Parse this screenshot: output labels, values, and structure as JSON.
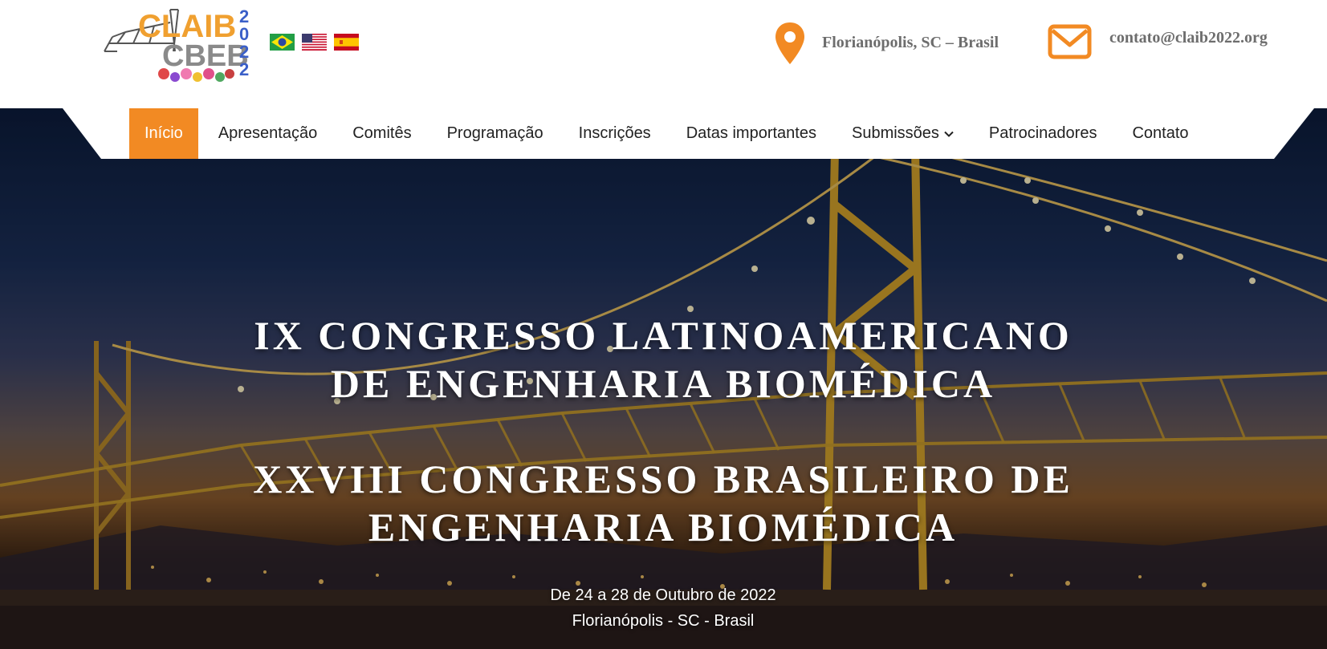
{
  "header": {
    "logo": {
      "top_text": "CLAIB",
      "bottom_text": "CBEB",
      "year_vertical": "2022"
    },
    "flags": [
      {
        "name": "brazil-flag-icon"
      },
      {
        "name": "usa-flag-icon"
      },
      {
        "name": "spain-flag-icon"
      }
    ],
    "location": {
      "icon": "map-pin-icon",
      "text": "Florianópolis, SC – Brasil"
    },
    "contact": {
      "icon": "envelope-icon",
      "text": "contato@claib2022.org"
    }
  },
  "nav": {
    "items": [
      {
        "label": "Início",
        "active": true
      },
      {
        "label": "Apresentação"
      },
      {
        "label": "Comitês"
      },
      {
        "label": "Programação"
      },
      {
        "label": "Inscrições"
      },
      {
        "label": "Datas importantes"
      },
      {
        "label": "Submissões",
        "dropdown": true
      },
      {
        "label": "Patrocinadores"
      },
      {
        "label": "Contato"
      }
    ]
  },
  "hero": {
    "title1": {
      "line1": "IX CONGRESSO LATINOAMERICANO",
      "line2": "DE ENGENHARIA BIOMÉDICA"
    },
    "title2": {
      "line1": "XXVIII CONGRESSO BRASILEIRO DE",
      "line2": "ENGENHARIA BIOMÉDICA"
    },
    "dates": "De 24 a 28 de Outubro de 2022",
    "place": "Florianópolis - SC - Brasil"
  },
  "colors": {
    "accent": "#f28a23",
    "logo_orange": "#f0a030",
    "logo_gray": "#8a8a8a",
    "logo_blue": "#3a5fc8",
    "header_text": "#6d6d6d"
  }
}
